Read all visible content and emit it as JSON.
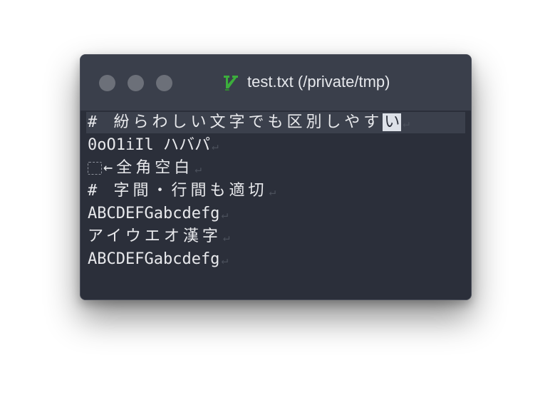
{
  "window": {
    "title": "test.txt (/private/tmp)",
    "app_icon": "vim-icon"
  },
  "editor": {
    "lines": [
      {
        "text": "# 紛らわしい文字でも区別しやす",
        "cursor_char": "い",
        "eol": "↵"
      },
      {
        "text": "0oO1iIl ハバパ",
        "eol": "↵"
      },
      {
        "text": "←全角空白",
        "eol": "↵",
        "fullwidth_space_marker": true
      },
      {
        "text": "# 字間・行間も適切",
        "eol": "↵"
      },
      {
        "text": "ABCDEFGabcdefg",
        "eol": "↵"
      },
      {
        "text": "アイウエオ漢字",
        "eol": "↵"
      },
      {
        "text": "ABCDEFGabcdefg",
        "eol": "↵"
      }
    ]
  },
  "colors": {
    "background": "#2b2f3a",
    "titlebar": "#3a3f4b",
    "current_line": "#3b404c",
    "text": "#e8e9ec",
    "eol_marker": "#4b505b",
    "traffic_light": "#6c7079",
    "vim_icon": "#3cae3c"
  }
}
